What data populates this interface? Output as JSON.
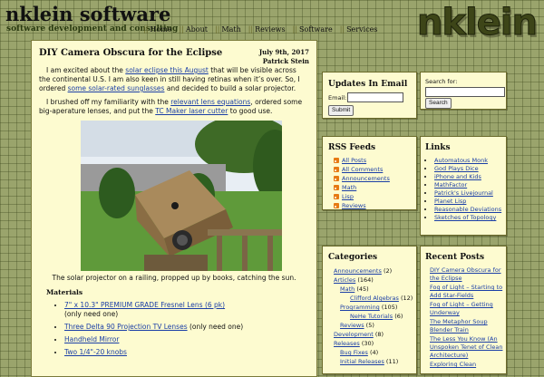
{
  "site": {
    "title": "nklein software",
    "tagline": "software development and consulting",
    "logo_text": "nklein"
  },
  "nav": [
    "Home",
    "About",
    "Math",
    "Reviews",
    "Software",
    "Services"
  ],
  "nav_separator": "||",
  "post": {
    "title": "DIY Camera Obscura for the Eclipse",
    "date": "July 9th, 2017",
    "author": "Patrick Stein",
    "p1": {
      "t1": "I am excited about the ",
      "link1": "solar eclipse this August",
      "t2": " that will be visible across the continental U.S. I am also keen in still having retinas when it’s over. So, I ordered ",
      "link2": "some solar-rated sunglasses",
      "t3": " and decided to build a solar projector."
    },
    "p2": {
      "t1": "I brushed off my familiarity with the ",
      "link1": "relevant lens equations",
      "t2": ", ordered some big-aperature lenses, and put the ",
      "link2": "TC Maker laser cutter",
      "t3": " to good use."
    },
    "caption": "The solar projector on a railing, propped up by books, catching the sun.",
    "materials_title": "Materials",
    "materials": [
      {
        "link": "7\" x 10.3\" PREMIUM GRADE Fresnel Lens (6 pk)",
        "note": "(only need one)"
      },
      {
        "link": "Three Delta 90 Projection TV Lenses",
        "note": " (only need one)"
      },
      {
        "link": "Handheld Mirror",
        "note": ""
      },
      {
        "link": "Two 1/4\"-20 knobs",
        "note": ""
      }
    ]
  },
  "email": {
    "heading": "Updates In Email",
    "label": "Email:",
    "value": "",
    "button": "Submit"
  },
  "search": {
    "label": "Search for:",
    "value": "",
    "button": "Search"
  },
  "rss": {
    "heading": "RSS Feeds",
    "icon": "rss-icon",
    "icon_color": "#e67a13",
    "items": [
      "All Posts",
      "All Comments",
      "Announcements",
      "Math",
      "Lisp",
      "Reviews"
    ]
  },
  "links": {
    "heading": "Links",
    "items": [
      "Automatous Monk",
      "God Plays Dice",
      "iPhone and Kids",
      "MathFactor",
      "Patrick's Livejournal",
      "Planet Lisp",
      "Reasonable Deviations",
      "Sketches of Topology"
    ]
  },
  "categories": {
    "heading": "Categories",
    "items": [
      {
        "name": "Announcements",
        "count": "(2)",
        "level": 0
      },
      {
        "name": "Articles",
        "count": "(164)",
        "level": 0
      },
      {
        "name": "Math",
        "count": "(45)",
        "level": 1
      },
      {
        "name": "Clifford Algebras",
        "count": "(12)",
        "level": 2
      },
      {
        "name": "Programming",
        "count": "(105)",
        "level": 1
      },
      {
        "name": "NeHe Tutorials",
        "count": "(6)",
        "level": 2
      },
      {
        "name": "Reviews",
        "count": "(5)",
        "level": 1
      },
      {
        "name": "Development",
        "count": "(8)",
        "level": 0
      },
      {
        "name": "Releases",
        "count": "(30)",
        "level": 0
      },
      {
        "name": "Bug Fixes",
        "count": "(4)",
        "level": 1
      },
      {
        "name": "Initial Releases",
        "count": "(11)",
        "level": 1
      }
    ]
  },
  "recent": {
    "heading": "Recent Posts",
    "items": [
      "DIY Camera Obscura for the Eclipse",
      "Fog of Light – Starting to Add Star-Fields",
      "Fog of Light – Getting Underway",
      "The Metaphor Soup Blender Train",
      "The Less You Know (An Unspoken Tenet of Clean Architecture)",
      "Exploring Clean"
    ]
  },
  "colors": {
    "background": "#9aa46c",
    "panel": "#fdfbd0",
    "link": "#1a3ea6",
    "logo": "#3d4518"
  }
}
